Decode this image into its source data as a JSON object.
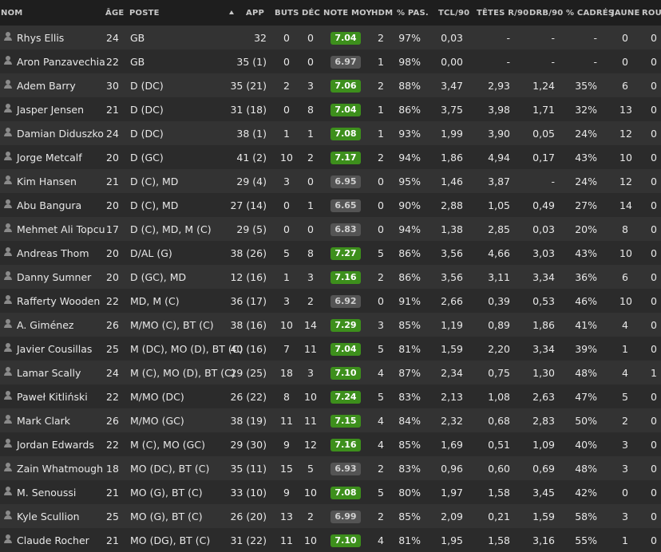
{
  "header": {
    "name": "NOM",
    "age": "ÂGE",
    "pos": "POSTE",
    "app": "APP",
    "buts": "BUTS",
    "dec": "DÉC",
    "note": "NOTE MOY",
    "hdm": "HDM",
    "pas": "% PAS.",
    "tcl": "TCL/90",
    "tetes": "TÊTES R/90",
    "drb": "DRB/90",
    "cad": "% CADRÉS",
    "jaune": "JAUNE",
    "rou": "ROU"
  },
  "colors": {
    "rating_good": "#3d8f1c",
    "rating_mid": "#545454"
  },
  "players": [
    {
      "name": "Rhys Ellis",
      "age": "24",
      "pos": "GB",
      "app": "32",
      "buts": "0",
      "dec": "0",
      "note": "7.04",
      "good": true,
      "hdm": "2",
      "pas": "97%",
      "tcl": "0,03",
      "tetes": "-",
      "drb": "-",
      "cad": "-",
      "jaune": "0",
      "rou": "0"
    },
    {
      "name": "Aron Panzavechia",
      "age": "22",
      "pos": "GB",
      "app": "35 (1)",
      "buts": "0",
      "dec": "0",
      "note": "6.97",
      "good": false,
      "hdm": "1",
      "pas": "98%",
      "tcl": "0,00",
      "tetes": "-",
      "drb": "-",
      "cad": "-",
      "jaune": "0",
      "rou": "0"
    },
    {
      "name": "Adem Barry",
      "age": "30",
      "pos": "D (DC)",
      "app": "35 (21)",
      "buts": "2",
      "dec": "3",
      "note": "7.06",
      "good": true,
      "hdm": "2",
      "pas": "88%",
      "tcl": "3,47",
      "tetes": "2,93",
      "drb": "1,24",
      "cad": "35%",
      "jaune": "6",
      "rou": "0"
    },
    {
      "name": "Jasper Jensen",
      "age": "21",
      "pos": "D (DC)",
      "app": "31 (18)",
      "buts": "0",
      "dec": "8",
      "note": "7.04",
      "good": true,
      "hdm": "1",
      "pas": "86%",
      "tcl": "3,75",
      "tetes": "3,98",
      "drb": "1,71",
      "cad": "32%",
      "jaune": "13",
      "rou": "0"
    },
    {
      "name": "Damian Diduszko",
      "age": "24",
      "pos": "D (DC)",
      "app": "38 (1)",
      "buts": "1",
      "dec": "1",
      "note": "7.08",
      "good": true,
      "hdm": "1",
      "pas": "93%",
      "tcl": "1,99",
      "tetes": "3,90",
      "drb": "0,05",
      "cad": "24%",
      "jaune": "12",
      "rou": "0"
    },
    {
      "name": "Jorge Metcalf",
      "age": "20",
      "pos": "D (GC)",
      "app": "41 (2)",
      "buts": "10",
      "dec": "2",
      "note": "7.17",
      "good": true,
      "hdm": "2",
      "pas": "94%",
      "tcl": "1,86",
      "tetes": "4,94",
      "drb": "0,17",
      "cad": "43%",
      "jaune": "10",
      "rou": "0"
    },
    {
      "name": "Kim Hansen",
      "age": "21",
      "pos": "D (C), MD",
      "app": "29 (4)",
      "buts": "3",
      "dec": "0",
      "note": "6.95",
      "good": false,
      "hdm": "0",
      "pas": "95%",
      "tcl": "1,46",
      "tetes": "3,87",
      "drb": "-",
      "cad": "24%",
      "jaune": "12",
      "rou": "0"
    },
    {
      "name": "Abu Bangura",
      "age": "20",
      "pos": "D (C), MD",
      "app": "27 (14)",
      "buts": "0",
      "dec": "1",
      "note": "6.65",
      "good": false,
      "hdm": "0",
      "pas": "90%",
      "tcl": "2,88",
      "tetes": "1,05",
      "drb": "0,49",
      "cad": "27%",
      "jaune": "14",
      "rou": "0"
    },
    {
      "name": "Mehmet Ali Topcu",
      "age": "17",
      "pos": "D (C), MD, M (C)",
      "app": "29 (5)",
      "buts": "0",
      "dec": "0",
      "note": "6.83",
      "good": false,
      "hdm": "0",
      "pas": "94%",
      "tcl": "1,38",
      "tetes": "2,85",
      "drb": "0,03",
      "cad": "20%",
      "jaune": "8",
      "rou": "0"
    },
    {
      "name": "Andreas Thom",
      "age": "20",
      "pos": "D/AL (G)",
      "app": "38 (26)",
      "buts": "5",
      "dec": "8",
      "note": "7.27",
      "good": true,
      "hdm": "5",
      "pas": "86%",
      "tcl": "3,56",
      "tetes": "4,66",
      "drb": "3,03",
      "cad": "43%",
      "jaune": "10",
      "rou": "0"
    },
    {
      "name": "Danny Sumner",
      "age": "20",
      "pos": "D (GC), MD",
      "app": "12 (16)",
      "buts": "1",
      "dec": "3",
      "note": "7.16",
      "good": true,
      "hdm": "2",
      "pas": "86%",
      "tcl": "3,56",
      "tetes": "3,11",
      "drb": "3,34",
      "cad": "36%",
      "jaune": "6",
      "rou": "0"
    },
    {
      "name": "Rafferty Wooden",
      "age": "22",
      "pos": "MD, M (C)",
      "app": "36 (17)",
      "buts": "3",
      "dec": "2",
      "note": "6.92",
      "good": false,
      "hdm": "0",
      "pas": "91%",
      "tcl": "2,66",
      "tetes": "0,39",
      "drb": "0,53",
      "cad": "46%",
      "jaune": "10",
      "rou": "0"
    },
    {
      "name": "A. Giménez",
      "age": "26",
      "pos": "M/MO (C), BT (C)",
      "app": "38 (16)",
      "buts": "10",
      "dec": "14",
      "note": "7.29",
      "good": true,
      "hdm": "3",
      "pas": "85%",
      "tcl": "1,19",
      "tetes": "0,89",
      "drb": "1,86",
      "cad": "41%",
      "jaune": "4",
      "rou": "0"
    },
    {
      "name": "Javier Cousillas",
      "age": "25",
      "pos": "M (DC), MO (D), BT (C)",
      "app": "40 (16)",
      "buts": "7",
      "dec": "11",
      "note": "7.04",
      "good": true,
      "hdm": "5",
      "pas": "81%",
      "tcl": "1,59",
      "tetes": "2,20",
      "drb": "3,34",
      "cad": "39%",
      "jaune": "1",
      "rou": "0"
    },
    {
      "name": "Lamar Scally",
      "age": "24",
      "pos": "M (C), MO (D), BT (C)",
      "app": "29 (25)",
      "buts": "18",
      "dec": "3",
      "note": "7.10",
      "good": true,
      "hdm": "4",
      "pas": "87%",
      "tcl": "2,34",
      "tetes": "0,75",
      "drb": "1,30",
      "cad": "48%",
      "jaune": "4",
      "rou": "1"
    },
    {
      "name": "Paweł Kitliński",
      "age": "22",
      "pos": "M/MO (DC)",
      "app": "26 (22)",
      "buts": "8",
      "dec": "10",
      "note": "7.24",
      "good": true,
      "hdm": "5",
      "pas": "83%",
      "tcl": "2,13",
      "tetes": "1,08",
      "drb": "2,63",
      "cad": "47%",
      "jaune": "5",
      "rou": "0"
    },
    {
      "name": "Mark Clark",
      "age": "26",
      "pos": "M/MO (GC)",
      "app": "38 (19)",
      "buts": "11",
      "dec": "11",
      "note": "7.15",
      "good": true,
      "hdm": "4",
      "pas": "84%",
      "tcl": "2,32",
      "tetes": "0,68",
      "drb": "2,83",
      "cad": "50%",
      "jaune": "2",
      "rou": "0"
    },
    {
      "name": "Jordan Edwards",
      "age": "22",
      "pos": "M (C), MO (GC)",
      "app": "29 (30)",
      "buts": "9",
      "dec": "12",
      "note": "7.16",
      "good": true,
      "hdm": "4",
      "pas": "85%",
      "tcl": "1,69",
      "tetes": "0,51",
      "drb": "1,09",
      "cad": "40%",
      "jaune": "3",
      "rou": "0"
    },
    {
      "name": "Zain Whatmough",
      "age": "18",
      "pos": "MO (DC), BT (C)",
      "app": "35 (11)",
      "buts": "15",
      "dec": "5",
      "note": "6.93",
      "good": false,
      "hdm": "2",
      "pas": "83%",
      "tcl": "0,96",
      "tetes": "0,60",
      "drb": "0,69",
      "cad": "48%",
      "jaune": "3",
      "rou": "0"
    },
    {
      "name": "M. Senoussi",
      "age": "21",
      "pos": "MO (G), BT (C)",
      "app": "33 (10)",
      "buts": "9",
      "dec": "10",
      "note": "7.08",
      "good": true,
      "hdm": "5",
      "pas": "80%",
      "tcl": "1,97",
      "tetes": "1,58",
      "drb": "3,45",
      "cad": "42%",
      "jaune": "0",
      "rou": "0"
    },
    {
      "name": "Kyle Scullion",
      "age": "25",
      "pos": "MO (G), BT (C)",
      "app": "26 (20)",
      "buts": "13",
      "dec": "2",
      "note": "6.99",
      "good": false,
      "hdm": "2",
      "pas": "85%",
      "tcl": "2,09",
      "tetes": "0,21",
      "drb": "1,59",
      "cad": "58%",
      "jaune": "3",
      "rou": "0"
    },
    {
      "name": "Claude Rocher",
      "age": "21",
      "pos": "MO (DG), BT (C)",
      "app": "31 (22)",
      "buts": "11",
      "dec": "10",
      "note": "7.10",
      "good": true,
      "hdm": "4",
      "pas": "81%",
      "tcl": "1,95",
      "tetes": "1,58",
      "drb": "3,16",
      "cad": "55%",
      "jaune": "1",
      "rou": "0"
    }
  ]
}
